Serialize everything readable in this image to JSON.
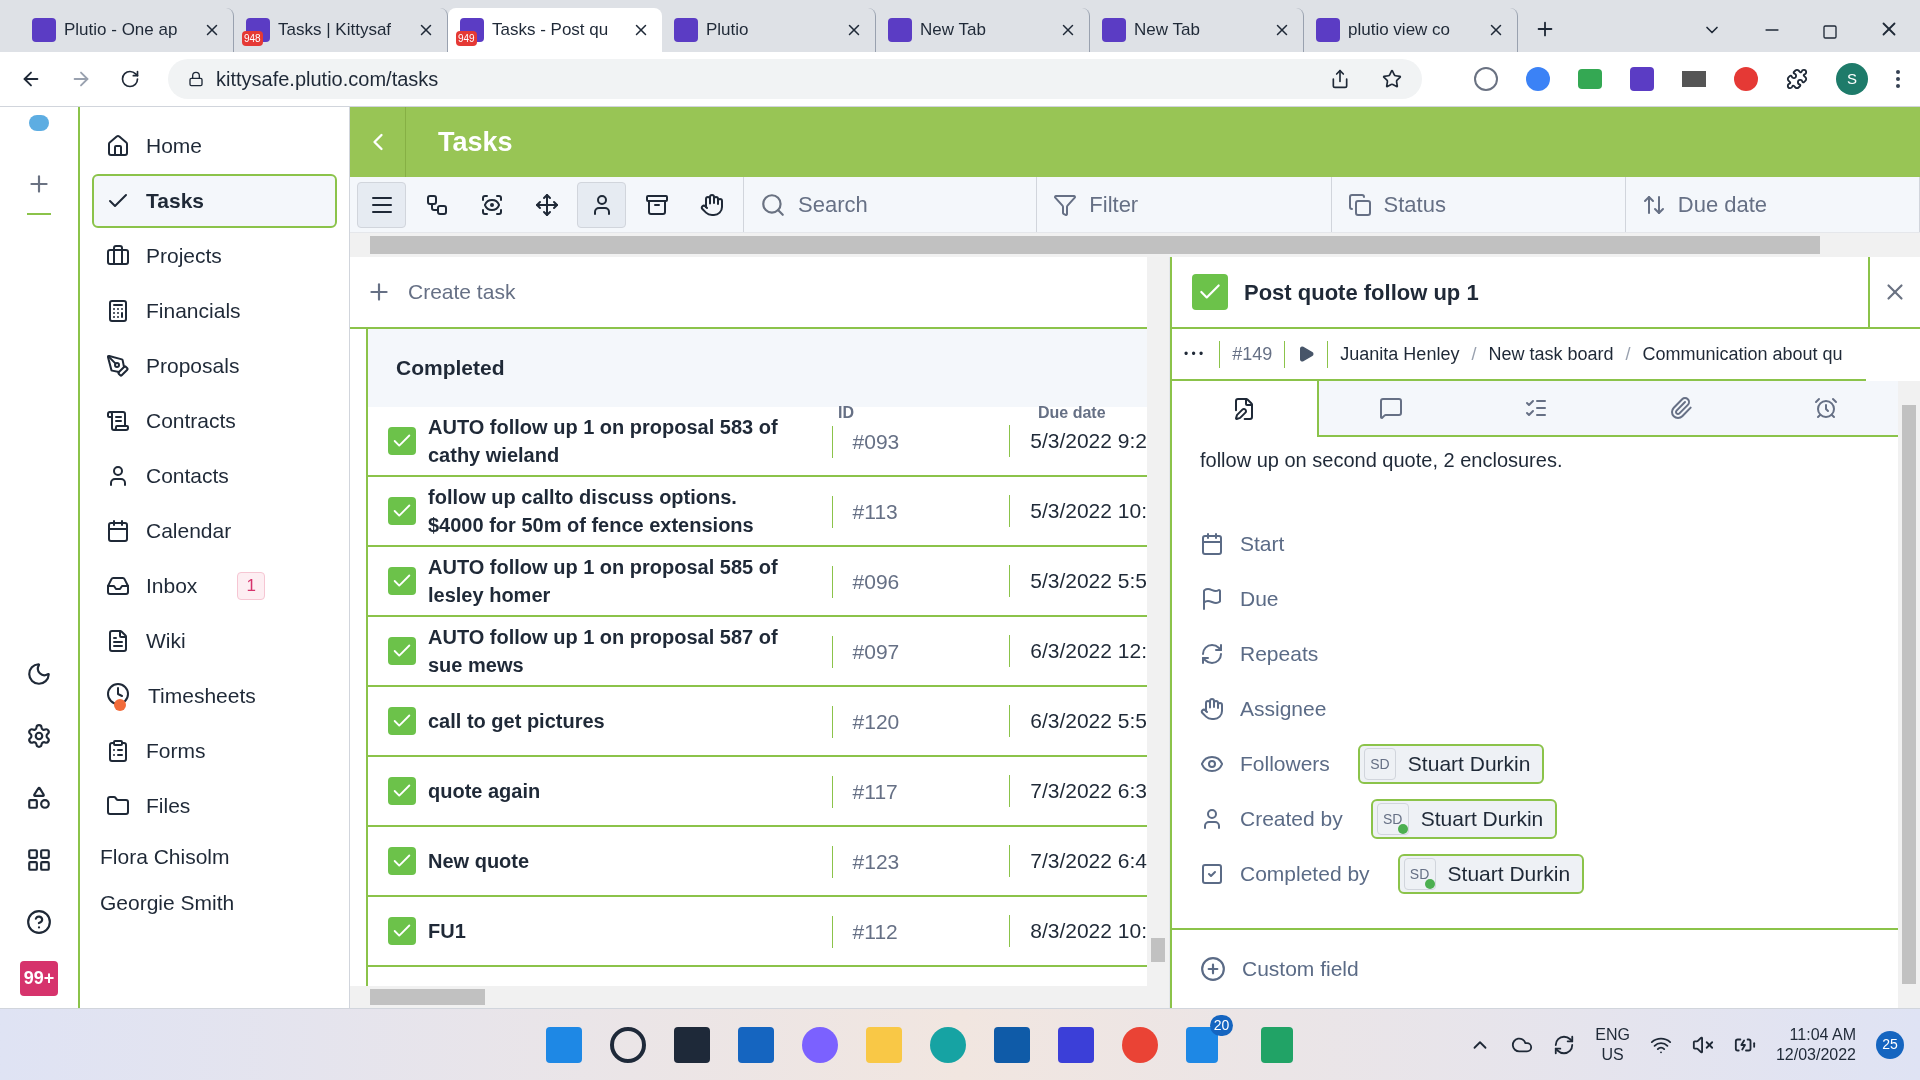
{
  "browser": {
    "tabs": [
      {
        "title": "Plutio - One ap",
        "selected": false
      },
      {
        "title": "Tasks | Kittysaf",
        "badge": "948",
        "selected": false
      },
      {
        "title": "Tasks - Post qu",
        "badge": "949",
        "selected": true
      },
      {
        "title": "Plutio",
        "selected": false
      },
      {
        "title": "New Tab",
        "selected": false
      },
      {
        "title": "New Tab",
        "selected": false
      },
      {
        "title": "plutio view co",
        "selected": false
      }
    ],
    "url": "kittysafe.plutio.com/tasks",
    "profile": "S"
  },
  "rail": {
    "badge": "99+"
  },
  "sidebar": {
    "items": [
      {
        "label": "Home",
        "selected": false
      },
      {
        "label": "Tasks",
        "selected": true
      },
      {
        "label": "Projects",
        "selected": false
      },
      {
        "label": "Financials",
        "selected": false
      },
      {
        "label": "Proposals",
        "selected": false
      },
      {
        "label": "Contracts",
        "selected": false
      },
      {
        "label": "Contacts",
        "selected": false
      },
      {
        "label": "Calendar",
        "selected": false
      },
      {
        "label": "Inbox",
        "badge": "1",
        "selected": false
      },
      {
        "label": "Wiki",
        "selected": false
      },
      {
        "label": "Timesheets",
        "dot": true,
        "selected": false
      },
      {
        "label": "Forms",
        "selected": false
      },
      {
        "label": "Files",
        "selected": false
      }
    ],
    "people": [
      "Flora Chisolm",
      "Georgie Smith"
    ]
  },
  "header": {
    "title": "Tasks"
  },
  "toolbar": {
    "views": [
      {
        "selected": true
      },
      {
        "selected": false
      },
      {
        "selected": false
      },
      {
        "selected": false
      },
      {
        "selected": true
      },
      {
        "selected": false
      },
      {
        "selected": false
      }
    ],
    "search": {
      "placeholder": "Search"
    },
    "filter": "Filter",
    "status": "Status",
    "sort": "Due date"
  },
  "list": {
    "create": "Create task",
    "group": "Completed",
    "columns": [
      "ID",
      "Due date"
    ],
    "rows": [
      {
        "title": "AUTO follow up 1 on proposal 583 of cathy wieland",
        "id": "#093",
        "due": "5/3/2022 9:2",
        "checked": true
      },
      {
        "title": "follow up callto discuss options. $4000 for 50m of fence extensions",
        "id": "#113",
        "due": "5/3/2022 10:",
        "checked": true
      },
      {
        "title": "AUTO follow up 1 on proposal 585 of lesley homer",
        "id": "#096",
        "due": "5/3/2022 5:5",
        "checked": true
      },
      {
        "title": "AUTO follow up 1 on proposal 587 of sue mews",
        "id": "#097",
        "due": "6/3/2022 12:",
        "checked": true
      },
      {
        "title": "call to get pictures",
        "id": "#120",
        "due": "6/3/2022 5:5",
        "checked": true
      },
      {
        "title": "quote again",
        "id": "#117",
        "due": "7/3/2022 6:3",
        "checked": true
      },
      {
        "title": "New quote",
        "id": "#123",
        "due": "7/3/2022 6:4",
        "checked": true
      },
      {
        "title": "FU1",
        "id": "#112",
        "due": "8/3/2022 10:",
        "checked": true
      }
    ]
  },
  "detail": {
    "title": "Post quote follow up 1",
    "checked": true,
    "more": "• • •",
    "id": "#149",
    "path": [
      "Juanita Henley",
      "New task board",
      "Communication about qu"
    ],
    "separator": "/",
    "tabs": [
      {
        "selected": true
      },
      {
        "selected": false
      },
      {
        "selected": false
      },
      {
        "selected": false
      },
      {
        "selected": false
      }
    ],
    "description": "follow up on second quote, 2 enclosures.",
    "fields": [
      {
        "label": "Start"
      },
      {
        "label": "Due"
      },
      {
        "label": "Repeats"
      },
      {
        "label": "Assignee"
      },
      {
        "label": "Followers",
        "people": [
          {
            "initials": "SD",
            "name": "Stuart Durkin",
            "online": false
          }
        ]
      },
      {
        "label": "Created by",
        "people": [
          {
            "initials": "SD",
            "name": "Stuart Durkin",
            "online": true
          }
        ]
      },
      {
        "label": "Completed by",
        "people": [
          {
            "initials": "SD",
            "name": "Stuart Durkin",
            "online": true
          }
        ]
      }
    ],
    "custom": "Custom field"
  },
  "taskbar": {
    "store_badge": "20",
    "lang": "ENG",
    "region": "US",
    "time": "11:04 AM",
    "date": "12/03/2022",
    "notifications": "25"
  }
}
